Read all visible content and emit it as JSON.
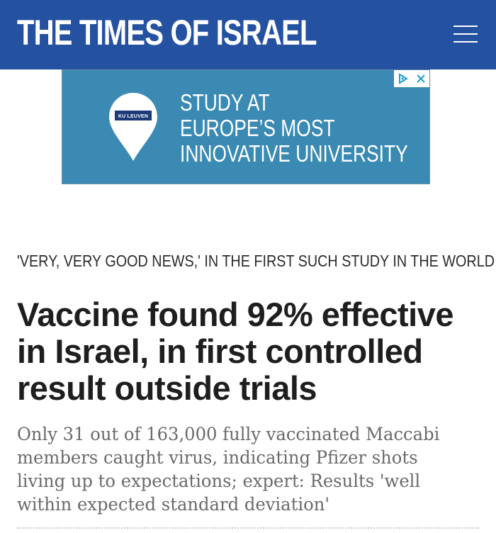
{
  "header": {
    "logo_text": "THE TIMES OF ISRAEL",
    "menu_icon": "hamburger-menu-icon",
    "background_color": "#2451a0"
  },
  "ad": {
    "brand_badge": "KU LEUVEN",
    "lines": [
      "STUDY AT",
      "EUROPE’S MOST",
      "INNOVATIVE UNIVERSITY"
    ],
    "background_color": "#3a8ab3",
    "adchoices_icon": "adchoices-icon",
    "close_icon": "close-icon"
  },
  "article": {
    "kicker": "'VERY, VERY GOOD NEWS,' IN THE FIRST SUCH STUDY IN THE WORLD",
    "headline": "Vaccine found 92% effective in Israel, in first controlled result outside trials",
    "subhead": "Only 31 out of 163,000 fully vaccinated Maccabi members caught virus, indicating Pfizer shots living up to expectations; expert: Results 'well within expected standard deviation'"
  }
}
